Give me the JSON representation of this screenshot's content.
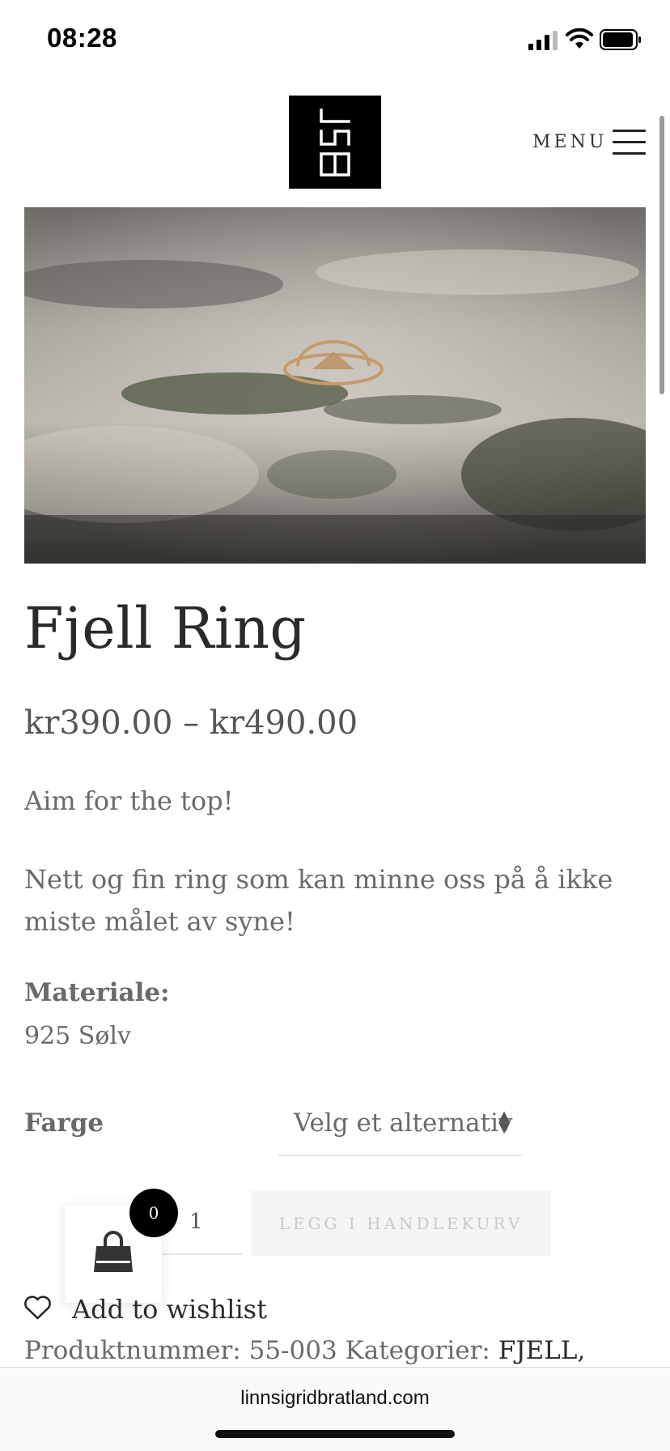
{
  "status_bar": {
    "time": "08:28",
    "signal_icon": "cellular-signal-icon",
    "wifi_icon": "wifi-icon",
    "battery_icon": "battery-icon"
  },
  "header": {
    "logo_text": "LSB",
    "menu_label": "MENU",
    "menu_icon": "hamburger-icon"
  },
  "product": {
    "title": "Fjell Ring",
    "price": "kr390.00 – kr490.00",
    "tagline": "Aim for the top!",
    "description": "Nett og fin ring som kan minne oss på å ikke miste målet av syne!",
    "material_label": "Materiale:",
    "material_value": "925 Sølv"
  },
  "variant": {
    "label": "Farge",
    "selected": "Velg et alternativ"
  },
  "cart": {
    "quantity": "1",
    "add_button": "LEGG I HANDLEKURV",
    "count": "0",
    "bag_icon": "shopping-bag-icon"
  },
  "wishlist": {
    "label": "Add to wishlist",
    "icon": "heart-icon"
  },
  "meta": {
    "sku_label": "Produktnummer:",
    "sku": "55-003",
    "categories_label": "Kategorier:",
    "category": "FJELL,"
  },
  "browser": {
    "url": "linnsigridbratland.com"
  },
  "colors": {
    "text_dark": "#2b2b2b",
    "text_muted": "#6a6a6a",
    "button_bg": "#f5f5f5",
    "button_text": "#c9c9c9",
    "badge_bg": "#000000"
  }
}
